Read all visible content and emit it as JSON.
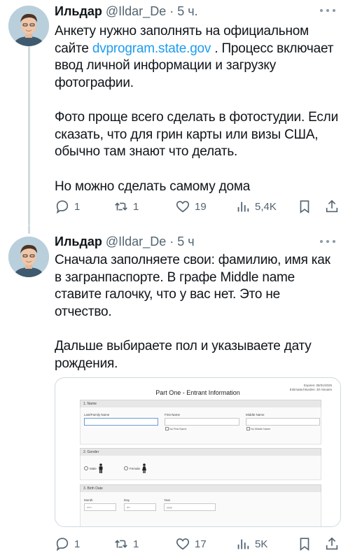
{
  "tweet1": {
    "author_name": "Ильдар",
    "handle": "@Ildar_De",
    "separator": "·",
    "time": "5 ч.",
    "text_p1_before": "Анкету нужно заполнять на официальном сайте ",
    "text_p1_link": "dvprogram.state.gov",
    "text_p1_after": " . Процесс включает ввод личной информации и загрузку фотографии.",
    "text_p2": "Фото проще всего сделать в фотостудии. Если сказать, что для грин карты или визы США, обычно там знают что делать.",
    "text_p3": "Но можно сделать самому дома",
    "replies": "1",
    "reposts": "1",
    "likes": "19",
    "views": "5,4K"
  },
  "tweet2": {
    "author_name": "Ильдар",
    "handle": "@Ildar_De",
    "separator": "·",
    "time": "5 ч",
    "text_p1": "Сначала заполняете свои: фамилию, имя как в загранпаспорте. В графе Middle name ставите галочку, что у вас нет. Это не отчество.",
    "text_p2": "Дальше выбираете пол и указываете дату рождения.",
    "replies": "1",
    "reposts": "1",
    "likes": "17",
    "views": "5K",
    "form": {
      "expires": "Expires: 08/31/2025",
      "burden": "Estimated Burden: 30 minutes",
      "title": "Part One - Entrant Information",
      "section1": "1. Name",
      "last_name_label": "Last/Family Name",
      "first_name_label": "First Name",
      "middle_name_label": "Middle Name",
      "no_first_name": "No First Name",
      "no_middle_name": "No Middle Name",
      "section2": "2. Gender",
      "male": "Male",
      "female": "Female",
      "section3": "3. Birth Date",
      "month_label": "Month",
      "day_label": "Day",
      "year_label": "Year",
      "month_ph": "mm",
      "day_ph": "dd",
      "year_ph": "yyyy"
    }
  },
  "icons": [
    "reply-icon",
    "repost-icon",
    "like-icon",
    "views-icon",
    "bookmark-icon",
    "share-icon",
    "more-icon"
  ],
  "colors": {
    "link": "#1d9bf0",
    "secondary": "#536471",
    "thread_line": "#cfd9de"
  }
}
